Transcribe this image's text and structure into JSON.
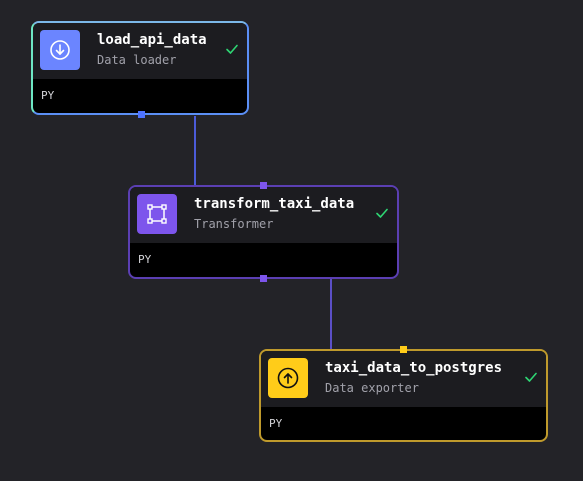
{
  "pipeline": {
    "blocks": [
      {
        "name": "load_api_data",
        "type_label": "Data loader",
        "language": "PY",
        "status": "success",
        "icon": "arrow-down-circle-icon",
        "color": "#6b85ff"
      },
      {
        "name": "transform_taxi_data",
        "type_label": "Transformer",
        "language": "PY",
        "status": "success",
        "icon": "square-selection-icon",
        "color": "#7d55ec"
      },
      {
        "name": "taxi_data_to_postgres",
        "type_label": "Data exporter",
        "language": "PY",
        "status": "success",
        "icon": "arrow-up-circle-icon",
        "color": "#ffcc19"
      }
    ],
    "edges": [
      {
        "from": "load_api_data",
        "to": "transform_taxi_data"
      },
      {
        "from": "transform_taxi_data",
        "to": "taxi_data_to_postgres"
      }
    ],
    "colors": {
      "canvas_background": "#232328",
      "success_check": "#2ed573",
      "loader_border_start": "#6ee7c4",
      "loader_border_end": "#4e73ff",
      "transformer_border": "#5b3fb3",
      "exporter_border": "#bf9a2c"
    }
  }
}
